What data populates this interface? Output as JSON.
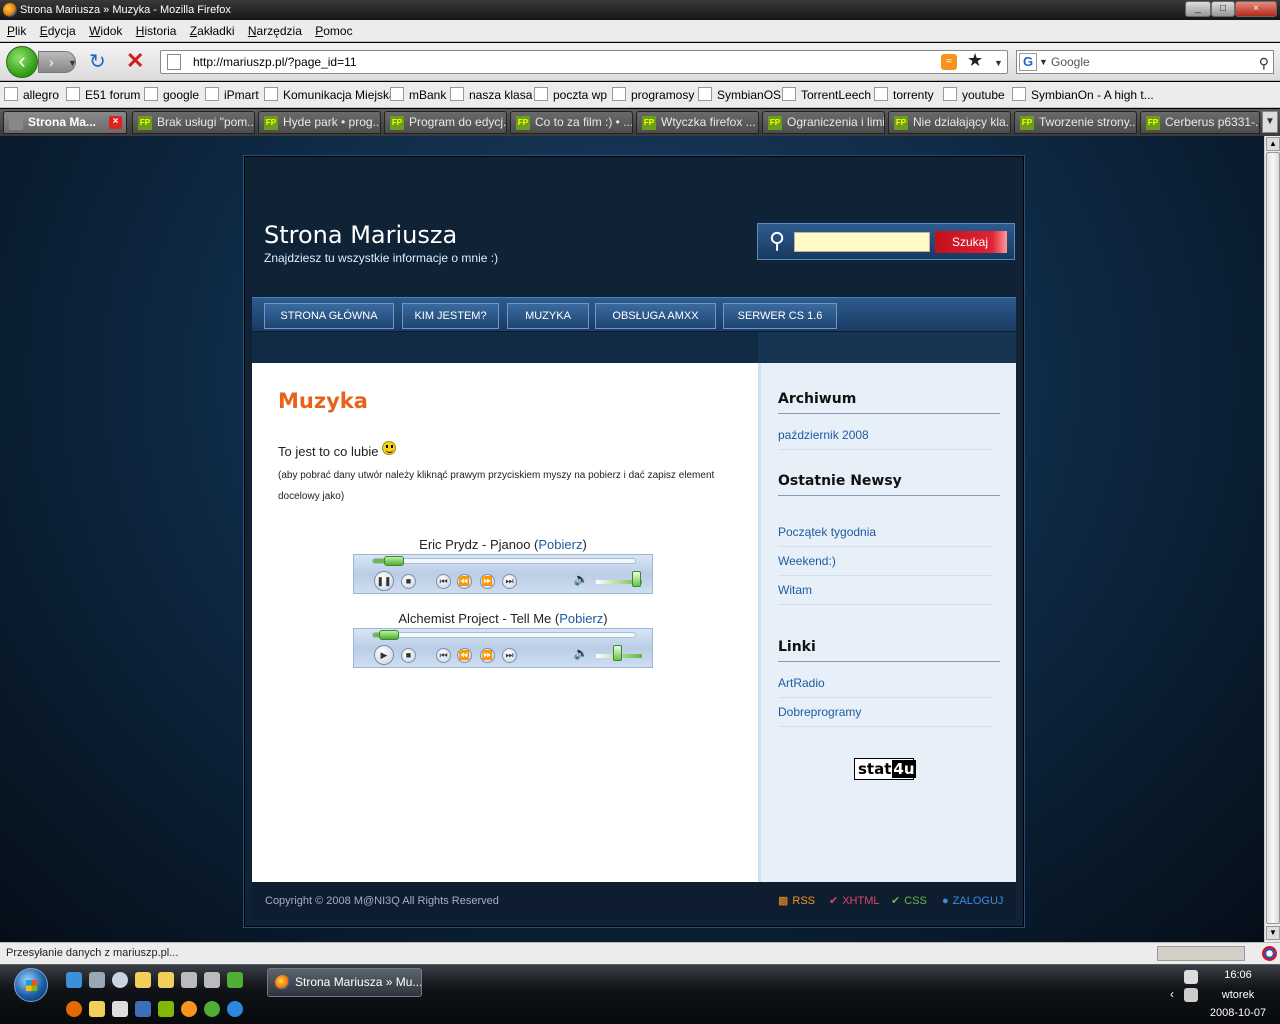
{
  "window": {
    "title": "Strona Mariusza » Muzyka - Mozilla Firefox",
    "controls": [
      "_",
      "□",
      "×"
    ]
  },
  "menu": [
    "Plik",
    "Edycja",
    "Widok",
    "Historia",
    "Zakładki",
    "Narzędzia",
    "Pomoc"
  ],
  "toolbar": {
    "url": "http://mariuszp.pl/?page_id=11",
    "search_placeholder": "Google",
    "search_engine_letter": "G"
  },
  "bookmarks": [
    "allegro",
    "E51 forum",
    "google",
    "iPmart",
    "Komunikacja Miejska",
    "mBank",
    "nasza klasa",
    "poczta wp",
    "programosy",
    "SymbianOS",
    "TorrentLeech",
    "torrenty",
    "youtube",
    "SymbianOn - A high t..."
  ],
  "tabs": [
    {
      "label": "Strona Ma...",
      "active": true
    },
    {
      "label": "Brak usługi \"pom...",
      "active": false
    },
    {
      "label": "Hyde park • prog...",
      "active": false
    },
    {
      "label": "Program do edycj...",
      "active": false
    },
    {
      "label": "Co to za film :) • ...",
      "active": false
    },
    {
      "label": "Wtyczka firefox ...",
      "active": false
    },
    {
      "label": "Ograniczenia i limi...",
      "active": false
    },
    {
      "label": "Nie działający kla...",
      "active": false
    },
    {
      "label": "Tworzenie strony...",
      "active": false
    },
    {
      "label": "Cerberus p6331-...",
      "active": false
    }
  ],
  "site": {
    "title": "Strona Mariusza",
    "tagline": "Znajdziesz tu wszystkie informacje o mnie :)",
    "search_button": "Szukaj",
    "nav": [
      "STRONA GŁÓWNA",
      "KIM JESTEM?",
      "MUZYKA",
      "OBSŁUGA AMXX",
      "SERWER CS 1.6"
    ],
    "page_title": "Muzyka",
    "intro": "To jest to co lubie",
    "note": "(aby pobrać dany utwór należy kliknąć prawym przyciskiem myszy na pobierz i dać zapisz element docelowy jako)",
    "tracks": [
      {
        "title": "Eric Prydz - Pjanoo",
        "link": "Pobierz",
        "state": "playing",
        "progress": 0.08,
        "volume": 1.0
      },
      {
        "title": "Alchemist Project - Tell Me",
        "link": "Pobierz",
        "state": "stopped",
        "progress": 0.06,
        "volume": 0.5
      }
    ],
    "sidebar": {
      "archive_heading": "Archiwum",
      "archive": [
        "październik 2008"
      ],
      "news_heading": "Ostatnie Newsy",
      "news": [
        "Początek tygodnia",
        "Weekend:)",
        "Witam"
      ],
      "links_heading": "Linki",
      "links": [
        "ArtRadio",
        "Dobreprogramy"
      ],
      "badge": {
        "prefix": "stat",
        "suffix": "4u"
      }
    },
    "footer": {
      "copyright": "Copyright © 2008 M@NI3Q All Rights Reserved",
      "links": [
        "RSS",
        "XHTML",
        "CSS",
        "ZALOGUJ"
      ]
    }
  },
  "status": "Przesyłanie danych z mariuszp.pl...",
  "taskbar": {
    "task": "Strona Mariusza » Mu...",
    "time": "16:06",
    "day": "wtorek",
    "date": "2008-10-07"
  },
  "colors": {
    "page_title": "#e8631a",
    "link": "#1f5aa0",
    "search_button": "#d01a26",
    "rss": "#f7931e",
    "xhtml": "#e0456b",
    "css": "#69b83a",
    "login": "#3b8fe0"
  }
}
